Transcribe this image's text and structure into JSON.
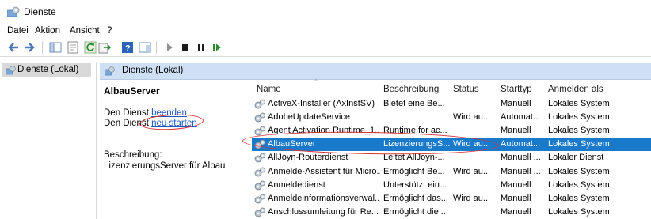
{
  "window": {
    "title": "Dienste"
  },
  "menu": [
    "Datei",
    "Aktion",
    "Ansicht",
    "?"
  ],
  "tree": {
    "item_label": "Dienste (Lokal)"
  },
  "content": {
    "header_title": "Dienste (Lokal)"
  },
  "detail": {
    "service_name": "AlbauServer",
    "stop_prefix": "Den Dienst ",
    "stop_link": "beenden",
    "restart_prefix": "Den Dienst ",
    "restart_link": "neu starten",
    "description_label": "Beschreibung:",
    "description_text": "LizenzierungsServer für Albau"
  },
  "list": {
    "columns": [
      "Name",
      "Beschreibung",
      "Status",
      "Starttyp",
      "Anmelden als"
    ],
    "selected_index": 3,
    "rows": [
      {
        "name": "ActiveX-Installer (AxInstSV)",
        "description": "Bietet eine Be...",
        "status": "",
        "starttype": "Manuell",
        "logon": "Lokales System"
      },
      {
        "name": "AdobeUpdateService",
        "description": "",
        "status": "Wird au...",
        "starttype": "Automat...",
        "logon": "Lokales System"
      },
      {
        "name": "Agent Activation Runtime_1...",
        "description": "Runtime for ac...",
        "status": "",
        "starttype": "Manuell",
        "logon": "Lokales System"
      },
      {
        "name": "AlbauServer",
        "description": "LizenzierungsS...",
        "status": "Wird au...",
        "starttype": "Automat...",
        "logon": "Lokales System"
      },
      {
        "name": "AllJoyn-Routerdienst",
        "description": "Leitet AllJoyn-...",
        "status": "",
        "starttype": "Manuell ...",
        "logon": "Lokaler Dienst"
      },
      {
        "name": "Anmelde-Assistent für Micro...",
        "description": "Ermöglicht Be...",
        "status": "Wird au...",
        "starttype": "Manuell ...",
        "logon": "Lokales System"
      },
      {
        "name": "Anmeldedienst",
        "description": "Unterstützt ein...",
        "status": "",
        "starttype": "Manuell",
        "logon": "Lokales System"
      },
      {
        "name": "Anmeldeinformationsverwal...",
        "description": "Ermöglicht das...",
        "status": "Wird au...",
        "starttype": "Manuell",
        "logon": "Lokales System"
      },
      {
        "name": "Anschlussumleitung für Re...",
        "description": "Ermöglicht die ...",
        "status": "",
        "starttype": "Manuell",
        "logon": "Lokales System"
      }
    ]
  },
  "colors": {
    "selection": "#1979ca",
    "header_band": "#cfe0f5",
    "link": "#1a55c0",
    "annotation": "#d83236"
  }
}
